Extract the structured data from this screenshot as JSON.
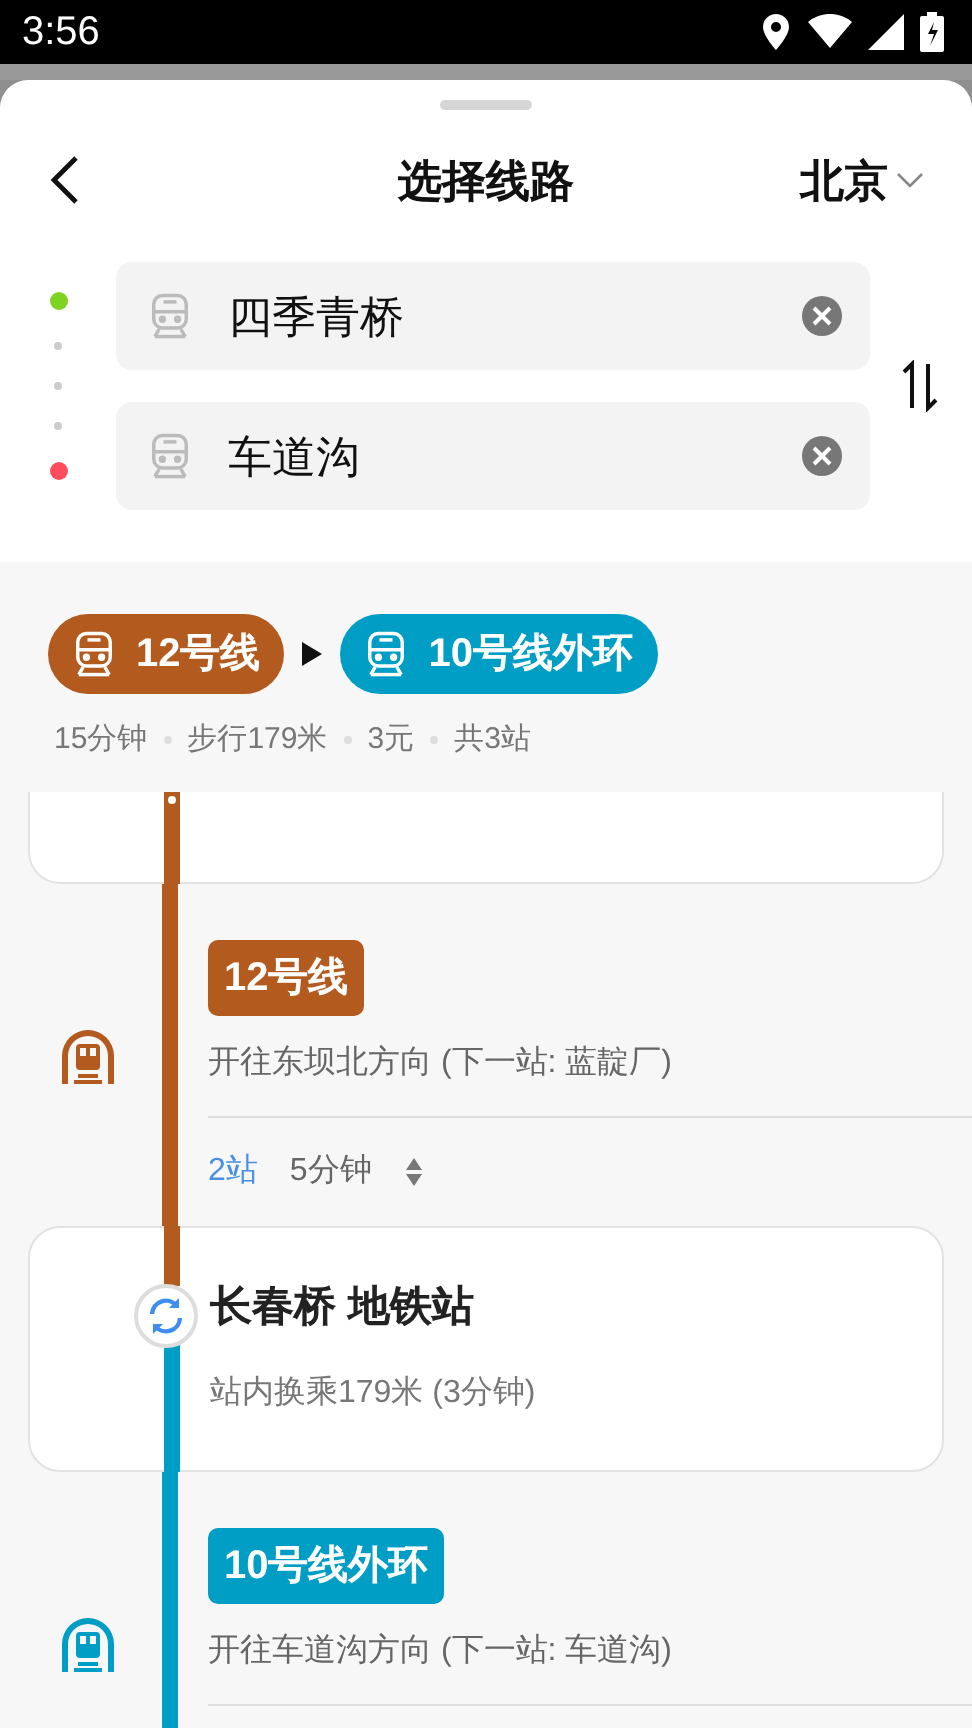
{
  "status_bar": {
    "time": "3:56"
  },
  "header": {
    "title": "选择线路",
    "city": "北京"
  },
  "stops": [
    {
      "color": "#7ed321",
      "value": "四季青桥"
    },
    {
      "color": "#ff4d5e",
      "value": "车道沟"
    }
  ],
  "route": {
    "lines": [
      {
        "name": "12号线",
        "color": "#b35a1f"
      },
      {
        "name": "10号线外环",
        "color": "#009dc4"
      }
    ],
    "stats": [
      "15分钟",
      "步行179米",
      "3元",
      "共3站"
    ]
  },
  "steps": [
    {
      "kind": "station",
      "color": "#b35a1f"
    },
    {
      "kind": "ride",
      "color": "#b35a1f",
      "badge": "12号线",
      "direction": "开往东坝北方向 (下一站: 蓝靛厂)",
      "stops": "2站",
      "duration": "5分钟"
    },
    {
      "kind": "transfer",
      "lines": [
        {
          "color": "#b35a1f"
        },
        {
          "color": "#009dc4"
        }
      ],
      "name": "长春桥 地铁站",
      "note": "站内换乘179米 (3分钟)"
    },
    {
      "kind": "ride",
      "color": "#009dc4",
      "badge": "10号线外环",
      "direction": "开往车道沟方向 (下一站: 车道沟)"
    }
  ]
}
